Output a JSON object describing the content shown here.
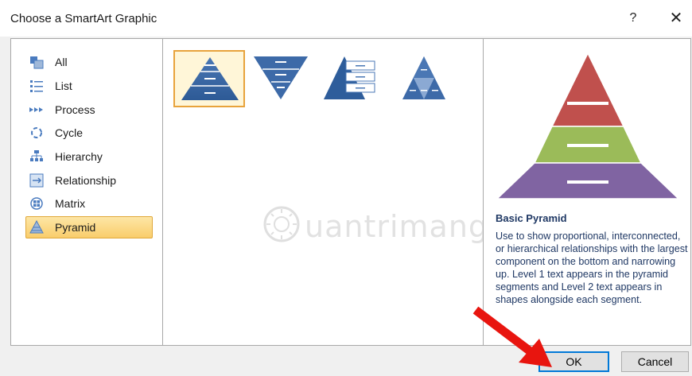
{
  "window": {
    "title": "Choose a SmartArt Graphic",
    "help_glyph": "?",
    "close_glyph": "✕"
  },
  "categories": [
    {
      "label": "All",
      "icon": "all-icon"
    },
    {
      "label": "List",
      "icon": "list-icon"
    },
    {
      "label": "Process",
      "icon": "process-icon"
    },
    {
      "label": "Cycle",
      "icon": "cycle-icon"
    },
    {
      "label": "Hierarchy",
      "icon": "hierarchy-icon"
    },
    {
      "label": "Relationship",
      "icon": "relationship-icon"
    },
    {
      "label": "Matrix",
      "icon": "matrix-icon"
    },
    {
      "label": "Pyramid",
      "icon": "pyramid-icon",
      "selected": true
    }
  ],
  "layouts": [
    {
      "icon": "basic-pyramid-icon",
      "selected": true
    },
    {
      "icon": "inverted-pyramid-icon"
    },
    {
      "icon": "pyramid-list-icon"
    },
    {
      "icon": "segmented-pyramid-icon"
    }
  ],
  "watermark": {
    "text": "uantrimang",
    "icon": "quantrimang-logo-icon"
  },
  "preview": {
    "title": "Basic Pyramid",
    "description": "Use to show proportional, interconnected, or hierarchical relationships with the largest component on the bottom and narrowing up. Level 1 text appears in the pyramid segments and Level 2 text appears in shapes alongside each segment.",
    "colors": {
      "top": "#c0504d",
      "middle": "#9bbb59",
      "bottom": "#8064a2"
    }
  },
  "buttons": {
    "ok": "OK",
    "cancel": "Cancel"
  },
  "colors": {
    "accent": "#0078d7",
    "selection": "#f9cd6b",
    "arrow": "#e8150f"
  }
}
